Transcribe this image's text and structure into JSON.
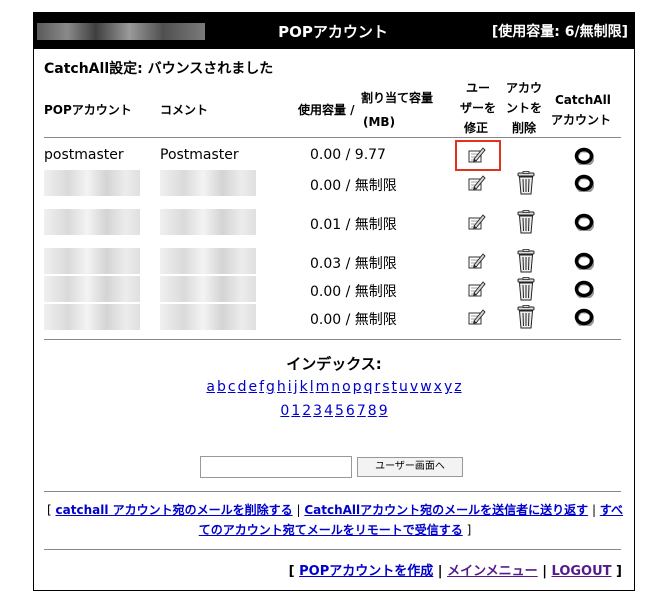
{
  "header": {
    "title": "POPアカウント",
    "usage": "[使用容量: 6/無制限]"
  },
  "status": "CatchAll設定: バウンスされました",
  "columns": {
    "account": "POPアカウント",
    "comment": "コメント",
    "usage_a": "使用容量 /",
    "quota_a": "割り当て容量",
    "quota_b": "(MB)",
    "edit_a": "ユー",
    "edit_b": "ザーを",
    "edit_c": "修正",
    "del_a": "アカウ",
    "del_b": "ントを",
    "del_c": "削除",
    "catch_a": "CatchAll",
    "catch_b": "アカウント"
  },
  "rows": [
    {
      "account": "postmaster",
      "comment": "Postmaster",
      "usage": "0.00 / 9.77"
    },
    {
      "usage": "0.00 / 無制限"
    },
    {
      "usage": "0.01 / 無制限"
    },
    {
      "usage": "0.03 / 無制限"
    },
    {
      "usage": "0.00 / 無制限"
    },
    {
      "usage": "0.00 / 無制限"
    }
  ],
  "index": {
    "title": "インデックス:",
    "letters": [
      "a",
      "b",
      "c",
      "d",
      "e",
      "f",
      "g",
      "h",
      "i",
      "j",
      "k",
      "l",
      "m",
      "n",
      "o",
      "p",
      "q",
      "r",
      "s",
      "t",
      "u",
      "v",
      "w",
      "x",
      "y",
      "z"
    ],
    "digits": [
      "0",
      "1",
      "2",
      "3",
      "4",
      "5",
      "6",
      "7",
      "8",
      "9"
    ]
  },
  "search": {
    "value": "",
    "button": "ユーザー画面へ"
  },
  "links": {
    "delete_catchall": "catchall アカウント宛のメールを削除する",
    "send_catchall": "CatchAllアカウント宛のメールを送信者に送り返す",
    "receive_all": "すべてのアカウント宛てメールをリモートで受信する"
  },
  "footer": {
    "create": "POPアカウントを作成",
    "menu": "メインメニュー",
    "logout": "LOGOUT"
  },
  "icons": {
    "edit": "edit-pencil-icon",
    "delete": "trash-icon",
    "catchall": "ring-icon"
  },
  "colors": {
    "titlebar": "#000000",
    "link": "#0000cc",
    "highlight": "#e0321c"
  }
}
